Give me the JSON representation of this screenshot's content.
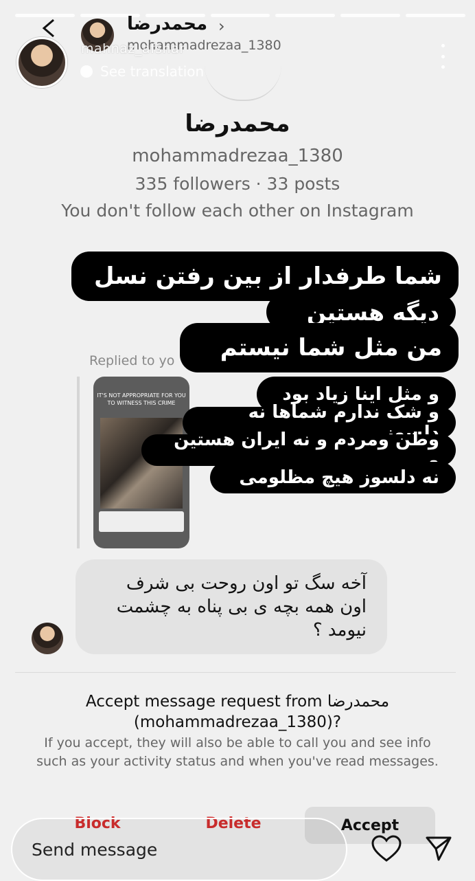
{
  "story": {
    "progress_segments": 7,
    "username": "mahnaz_afshar",
    "see_translation": "See translation"
  },
  "dm_header": {
    "name": "محمدرضا",
    "handle": "mohammadrezaa_1380",
    "chevron": "›"
  },
  "profile": {
    "name": "محمدرضا",
    "handle": "mohammadrezaa_1380",
    "stats": "335 followers · 33 posts",
    "follow_status": "You don't follow each other on Instagram"
  },
  "reply": {
    "label": "Replied to yo",
    "preview_title": "IT'S NOT APPROPRIATE FOR YOU TO WITNESS THIS CRIME"
  },
  "stickers": [
    "شما طرفدار از بین رفتن نسل",
    "دیگه هستین",
    "من مثل شما نیستم",
    "و مثل اینا زیاد بود",
    "و شک ندارم شماها نه دلسوز",
    "وطن ومردم و نه ایران هستین و",
    "نه دلسوز هیچ مظلومی"
  ],
  "message": {
    "text": "آخه سگ تو اون روحت بی شرف اون همه بچه ی بی پناه به چشمت نیومد ؟"
  },
  "request": {
    "title_prefix": "Accept message request from",
    "title_name": "محمدرضا",
    "title_handle": "(mohammadrezaa_1380)?",
    "body": "If you accept, they will also be able to call you and see info such as your activity status and when you've read messages."
  },
  "actions": {
    "block": "Block",
    "delete": "Delete",
    "accept": "Accept"
  },
  "composer": {
    "placeholder": "Send message"
  },
  "colors": {
    "danger": "#d32f2f",
    "sticker_bg": "#000000",
    "bubble_bg": "#e3e3e3"
  }
}
